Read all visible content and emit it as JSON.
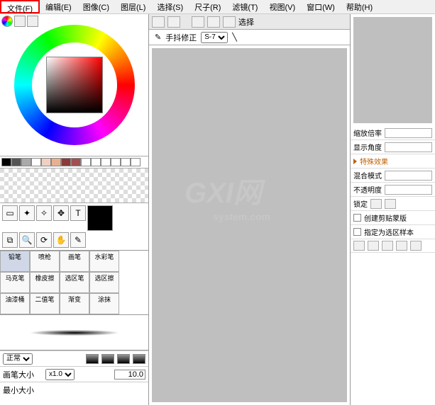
{
  "menu": {
    "file": "文件(F)",
    "edit": "编辑(E)",
    "image": "图像(C)",
    "layer": "图层(L)",
    "select": "选择(S)",
    "ruler": "尺子(R)",
    "filter": "滤镜(T)",
    "view": "视图(V)",
    "window": "窗口(W)",
    "help": "帮助(H)"
  },
  "swatches": [
    "#000000",
    "#555555",
    "#aaaaaa",
    "#ffffff",
    "#f0d0c0",
    "#e8b090",
    "#8b3a3a",
    "#a05050",
    "#ffffff",
    "#ffffff",
    "#ffffff",
    "#ffffff",
    "#ffffff",
    "#ffffff"
  ],
  "tools": {
    "row1": [
      "select-rect",
      "lasso",
      "magic-wand",
      "move",
      "text"
    ],
    "row2": [
      "transform",
      "zoom",
      "rotate",
      "hand",
      "eyedropper"
    ]
  },
  "brushes": [
    {
      "name": "铅笔",
      "active": true
    },
    {
      "name": "喷枪"
    },
    {
      "name": "画笔"
    },
    {
      "name": "水彩笔"
    },
    {
      "name": "马克笔"
    },
    {
      "name": "橡皮擦"
    },
    {
      "name": "选区笔"
    },
    {
      "name": "选区擦"
    },
    {
      "name": "油漆桶"
    },
    {
      "name": "二值笔"
    },
    {
      "name": "渐变"
    },
    {
      "name": "涂抹"
    }
  ],
  "brush_props": {
    "mode_label": "正常",
    "size_label": "画笔大小",
    "size_mult": "x1.0",
    "size_val": "10.0",
    "min_size_label": "最小大小"
  },
  "canvas_bar": {
    "select_label": "选择",
    "stabilizer_icon": "✎",
    "stabilizer_label": "手抖修正",
    "stabilizer_val": "S-7"
  },
  "right": {
    "zoom_label": "缩放倍率",
    "angle_label": "显示角度",
    "fx_label": "特殊效果",
    "blend_label": "混合模式",
    "opacity_label": "不透明度",
    "lock_label": "锁定",
    "clip_label": "创建剪贴蒙版",
    "mark_sel_label": "指定为选区样本"
  },
  "watermark": {
    "main": "GXI网",
    "sub": "system.com"
  }
}
